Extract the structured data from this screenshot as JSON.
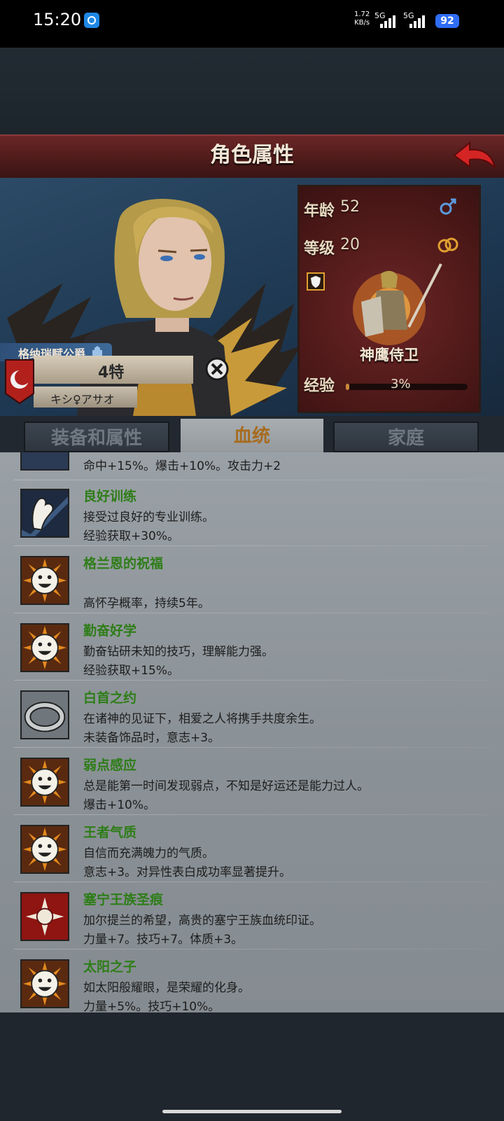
{
  "status": {
    "time": "15:20",
    "net_speed_top": "1.72",
    "net_speed_bottom": "KB/s",
    "sig1": "5G",
    "sig2": "5G",
    "battery": "92"
  },
  "header": {
    "title": "角色属性"
  },
  "character": {
    "title": "格纳瑞赋公爵",
    "name": "4特",
    "sub_name": "キシ♀アサオ",
    "age_label": "年龄",
    "age_value": "52",
    "level_label": "等级",
    "level_value": "20",
    "class_name": "神鹰侍卫",
    "exp_label": "经验",
    "exp_value": "3%",
    "exp_fraction": 0.03
  },
  "tabs": [
    {
      "label": "装备和属性",
      "active": false
    },
    {
      "label": "血统",
      "active": true
    },
    {
      "label": "家庭",
      "active": false
    }
  ],
  "partial_row": {
    "line": "命中+15%。爆击+10%。攻击力+2"
  },
  "traits": [
    {
      "icon": "arm-icon",
      "name": "良好训练",
      "line1": "接受过良好的专业训练。",
      "line2": "经验获取+30%。"
    },
    {
      "icon": "sun-face-icon",
      "name": "格兰恩的祝福",
      "line1": "",
      "line2": "高怀孕概率，持续5年。"
    },
    {
      "icon": "sun-face-icon",
      "name": "勤奋好学",
      "line1": "勤奋钻研未知的技巧，理解能力强。",
      "line2": "经验获取+15%。"
    },
    {
      "icon": "ring-icon",
      "name": "白首之约",
      "line1": "在诸神的见证下，相爱之人将携手共度余生。",
      "line2": "未装备饰品时，意志+3。"
    },
    {
      "icon": "sun-face-icon",
      "name": "弱点感应",
      "line1": "总是能第一时间发现弱点，不知是好运还是能力过人。",
      "line2": "爆击+10%。"
    },
    {
      "icon": "sun-face-icon",
      "name": "王者气质",
      "line1": "自信而充满魄力的气质。",
      "line2": "意志+3。对异性表白成功率显著提升。"
    },
    {
      "icon": "emblem-icon",
      "name": "塞宁王族圣痕",
      "line1": "加尔提兰的希望，高贵的塞宁王族血统印证。",
      "line2": "力量+7。技巧+7。体质+3。"
    },
    {
      "icon": "sun-face-icon",
      "name": "太阳之子",
      "line1": "如太阳般耀眼，是荣耀的化身。",
      "line2": "力量+5%。技巧+10%。"
    }
  ]
}
